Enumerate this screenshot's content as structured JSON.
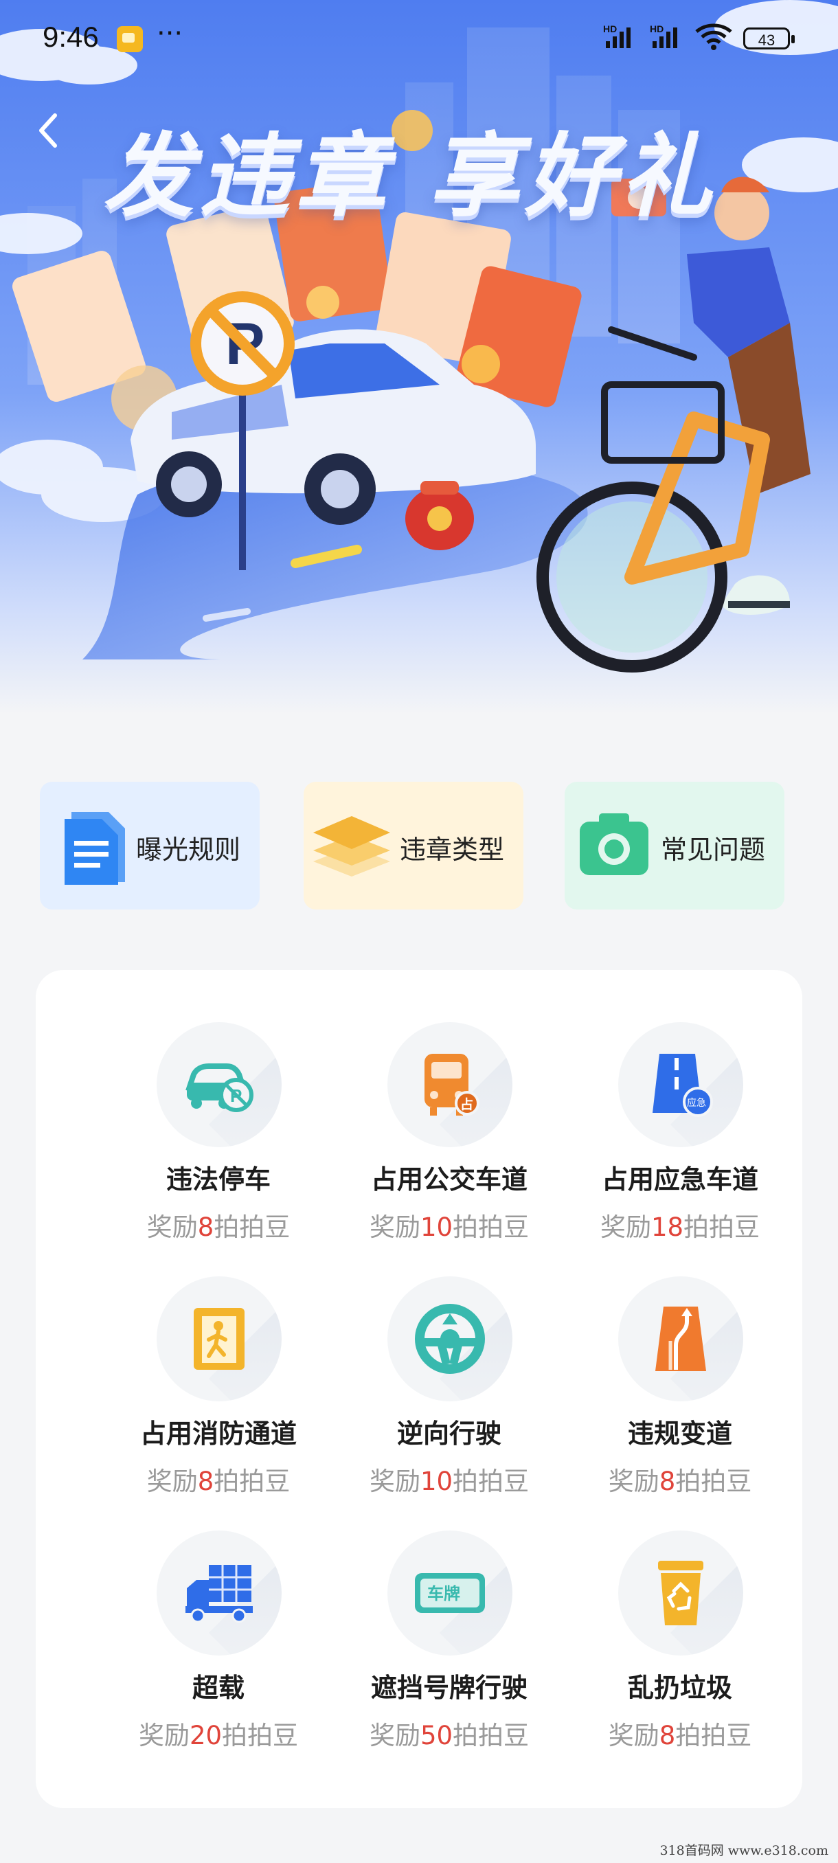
{
  "status_bar": {
    "time": "9:46",
    "dots": "···",
    "hd1": "HD",
    "hd2": "HD",
    "battery": "43"
  },
  "banner": {
    "title": "发违章 享好礼"
  },
  "shortcuts": [
    {
      "label": "曝光规则",
      "icon": "document-icon"
    },
    {
      "label": "违章类型",
      "icon": "layers-icon"
    },
    {
      "label": "常见问题",
      "icon": "camera-icon"
    }
  ],
  "violations": [
    {
      "name": "违法停车",
      "reward_prefix": "奖励",
      "reward_value": "8",
      "reward_suffix": "拍拍豆",
      "icon": "no-parking-car-icon"
    },
    {
      "name": "占用公交车道",
      "reward_prefix": "奖励",
      "reward_value": "10",
      "reward_suffix": "拍拍豆",
      "icon": "bus-lane-icon"
    },
    {
      "name": "占用应急车道",
      "reward_prefix": "奖励",
      "reward_value": "18",
      "reward_suffix": "拍拍豆",
      "icon": "emergency-lane-icon",
      "badge": "应急"
    },
    {
      "name": "占用消防通道",
      "reward_prefix": "奖励",
      "reward_value": "8",
      "reward_suffix": "拍拍豆",
      "icon": "fire-exit-icon"
    },
    {
      "name": "逆向行驶",
      "reward_prefix": "奖励",
      "reward_value": "10",
      "reward_suffix": "拍拍豆",
      "icon": "steering-wheel-icon"
    },
    {
      "name": "违规变道",
      "reward_prefix": "奖励",
      "reward_value": "8",
      "reward_suffix": "拍拍豆",
      "icon": "lane-change-icon"
    },
    {
      "name": "超载",
      "reward_prefix": "奖励",
      "reward_value": "20",
      "reward_suffix": "拍拍豆",
      "icon": "overloaded-truck-icon"
    },
    {
      "name": "遮挡号牌行驶",
      "reward_prefix": "奖励",
      "reward_value": "50",
      "reward_suffix": "拍拍豆",
      "icon": "license-plate-icon",
      "badge": "车牌"
    },
    {
      "name": "乱扔垃圾",
      "reward_prefix": "奖励",
      "reward_value": "8",
      "reward_suffix": "拍拍豆",
      "icon": "trash-can-icon"
    }
  ],
  "colors": {
    "reward_number": "#e0443a",
    "page_background": "#f4f5f7",
    "banner_sky": "#5b86f2"
  },
  "watermark": "318首码网  www.e318.com"
}
